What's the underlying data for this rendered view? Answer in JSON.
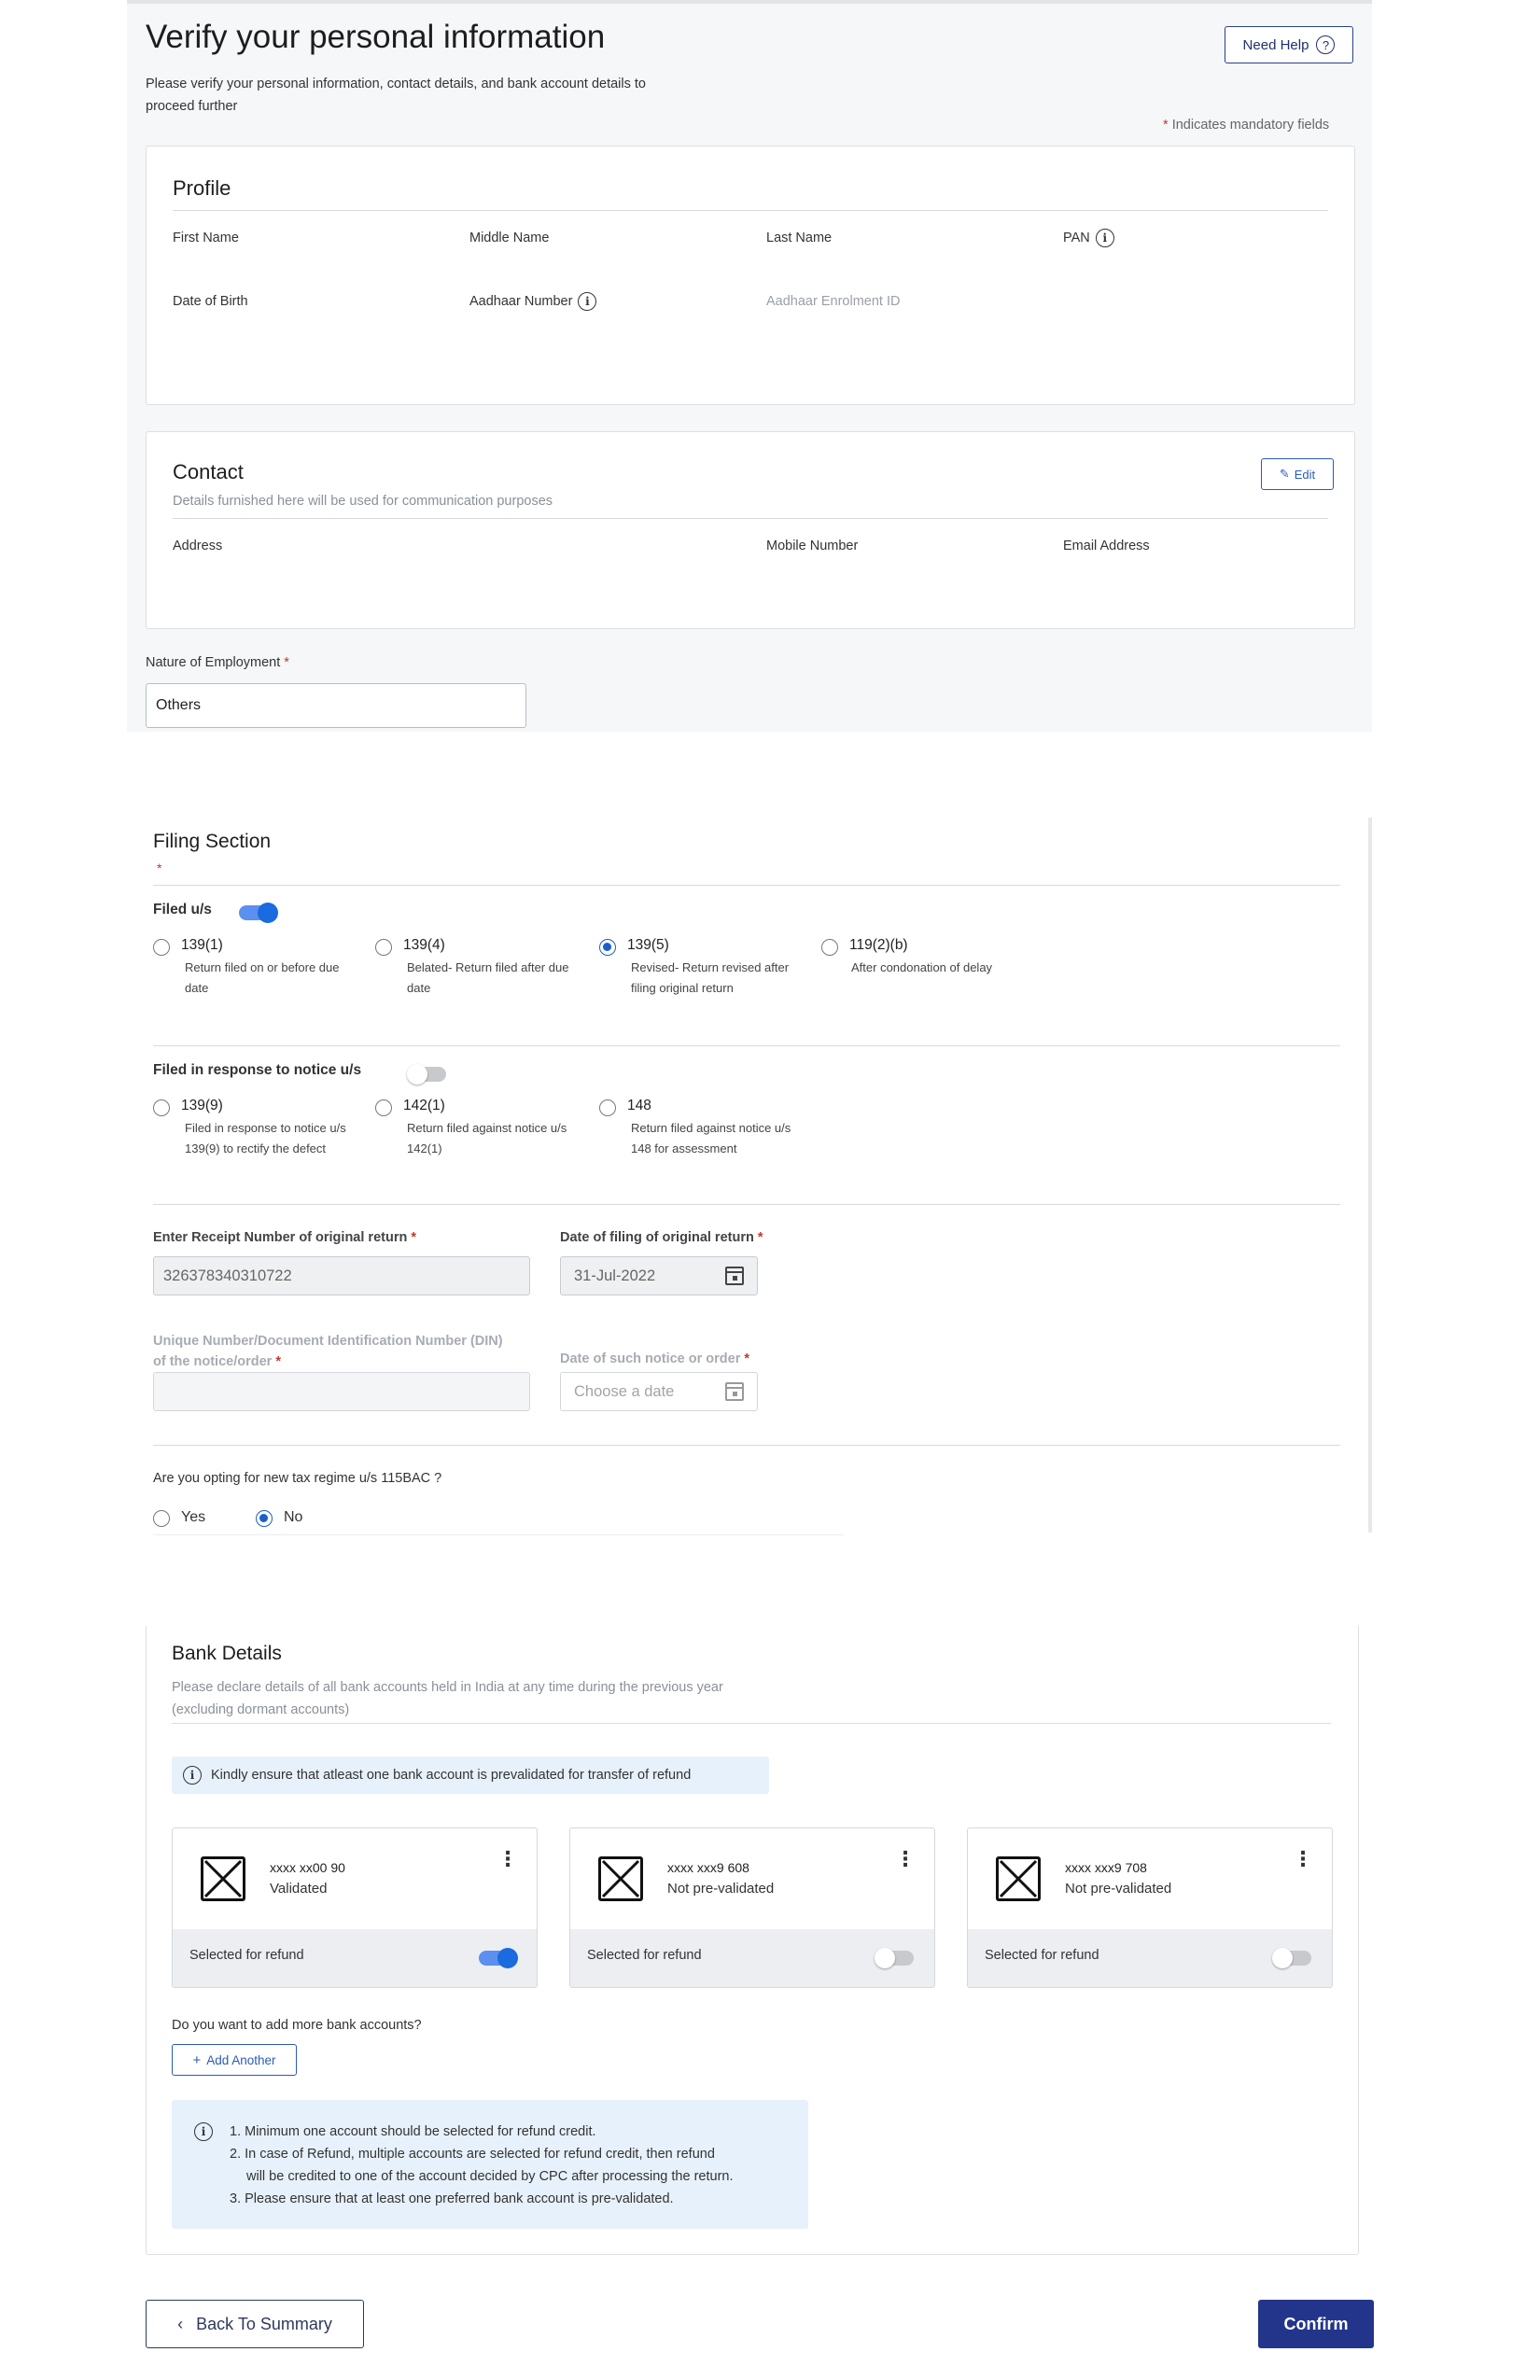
{
  "header": {
    "title": "Verify your personal information",
    "subtitle_line1": "Please verify your personal information, contact details, and bank account details to",
    "subtitle_line2": "proceed further",
    "need_help_label": "Need Help",
    "mandatory_note": "Indicates mandatory fields",
    "mandatory_star": "*"
  },
  "profile": {
    "title": "Profile",
    "fields": {
      "first_name": "First Name",
      "middle_name": "Middle Name",
      "last_name": "Last Name",
      "pan": "PAN",
      "dob": "Date of Birth",
      "aadhaar": "Aadhaar Number",
      "aadhaar_enrolment": "Aadhaar Enrolment ID"
    }
  },
  "contact": {
    "title": "Contact",
    "subtitle": "Details furnished here will be used for communication purposes",
    "edit_label": "Edit",
    "fields": {
      "address": "Address",
      "mobile": "Mobile Number",
      "email": "Email Address"
    }
  },
  "employment": {
    "label": "Nature of Employment",
    "star": "*",
    "value": "Others"
  },
  "filing": {
    "title": "Filing Section",
    "star": "*",
    "filed_us_label": "Filed u/s",
    "filed_us_toggle": true,
    "options": [
      {
        "code": "139(1)",
        "desc1": "Return filed on or before due",
        "desc2": "date",
        "selected": false
      },
      {
        "code": "139(4)",
        "desc1": "Belated- Return filed after due",
        "desc2": "date",
        "selected": false
      },
      {
        "code": "139(5)",
        "desc1": "Revised- Return revised after",
        "desc2": "filing original return",
        "selected": true
      },
      {
        "code": "119(2)(b)",
        "desc1": "After condonation of delay",
        "desc2": "",
        "selected": false
      }
    ],
    "notice_label": "Filed in response to notice u/s",
    "notice_toggle": false,
    "notice_options": [
      {
        "code": "139(9)",
        "desc1": "Filed in response to notice u/s",
        "desc2": "139(9) to rectify the defect"
      },
      {
        "code": "142(1)",
        "desc1": "Return filed against notice u/s",
        "desc2": "142(1)"
      },
      {
        "code": "148",
        "desc1": "Return filed against notice u/s",
        "desc2": "148 for assessment"
      }
    ],
    "receipt_label": "Enter Receipt Number of original return",
    "receipt_value": "326378340310722",
    "date_filing_label": "Date of filing of original return",
    "date_filing_value": "31-Jul-2022",
    "din_label_line1": "Unique Number/Document Identification Number (DIN)",
    "din_label_line2": "of the notice/order",
    "din_value": "",
    "notice_date_label": "Date of such notice or order",
    "notice_date_placeholder": "Choose a date",
    "regime_question": "Are you opting for new tax regime u/s 115BAC ?",
    "regime_yes": "Yes",
    "regime_no": "No",
    "regime_selected": "No",
    "req_star": "*"
  },
  "bank": {
    "title": "Bank Details",
    "subtitle_line1": "Please declare details of all bank accounts held in India at any time during the previous year",
    "subtitle_line2": "(excluding dormant accounts)",
    "info_banner": "Kindly ensure that atleast one bank account is prevalidated for transfer of refund",
    "accounts": [
      {
        "number": "xxxx xx00 90",
        "status": "Validated",
        "refund_label": "Selected for refund",
        "selected": true
      },
      {
        "number": "xxxx xxx9 608",
        "status": "Not pre-validated",
        "refund_label": "Selected for refund",
        "selected": false
      },
      {
        "number": "xxxx xxx9 708",
        "status": "Not pre-validated",
        "refund_label": "Selected for refund",
        "selected": false
      }
    ],
    "add_more_question": "Do you want to add more bank accounts?",
    "add_another_label": "Add Another",
    "notes": [
      "1. Minimum one account should be selected for refund credit.",
      "2. In case of Refund, multiple accounts are selected for refund credit, then refund",
      "will be credited to one of the account decided by CPC after processing the return.",
      "3. Please ensure that at least one preferred bank account is pre-validated."
    ]
  },
  "footer": {
    "back_label": "Back To Summary",
    "confirm_label": "Confirm"
  },
  "colors": {
    "primary": "#23358a",
    "accent_blue": "#1a5fd0",
    "required": "#c0392b",
    "info_bg": "#e7f1fb"
  }
}
